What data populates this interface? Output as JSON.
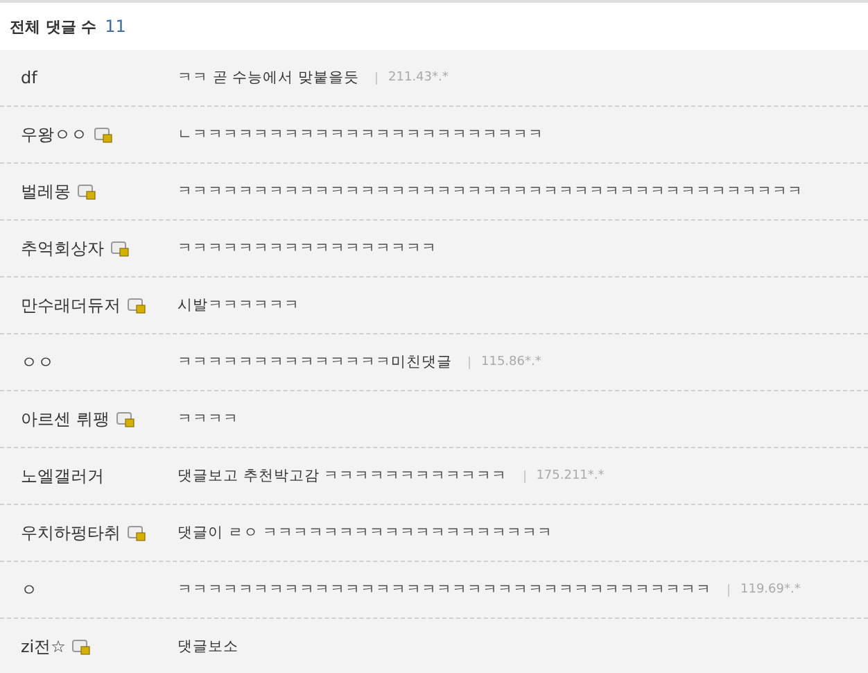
{
  "header": {
    "label": "전체 댓글 수",
    "count": "11"
  },
  "comments": [
    {
      "name": "df",
      "member_icon": false,
      "text": "ㅋㅋ 곧 수능에서 맞붙을듯",
      "ip": "211.43*.*"
    },
    {
      "name": "우왕ㅇㅇ",
      "member_icon": true,
      "text": "ㄴㅋㅋㅋㅋㅋㅋㅋㅋㅋㅋㅋㅋㅋㅋㅋㅋㅋㅋㅋㅋㅋㅋㅋ"
    },
    {
      "name": "벌레몽",
      "member_icon": true,
      "text": "ㅋㅋㅋㅋㅋㅋㅋㅋㅋㅋㅋㅋㅋㅋㅋㅋㅋㅋㅋㅋㅋㅋㅋㅋㅋㅋㅋㅋㅋㅋㅋㅋㅋㅋㅋㅋㅋㅋㅋㅋㅋ"
    },
    {
      "name": "추억회상자",
      "member_icon": true,
      "text": "ㅋㅋㅋㅋㅋㅋㅋㅋㅋㅋㅋㅋㅋㅋㅋㅋㅋ"
    },
    {
      "name": "만수래더듀저",
      "member_icon": true,
      "text": "시발ㅋㅋㅋㅋㅋㅋ"
    },
    {
      "name": "ㅇㅇ",
      "member_icon": false,
      "text": "ㅋㅋㅋㅋㅋㅋㅋㅋㅋㅋㅋㅋㅋㅋ미친댓글",
      "ip": "115.86*.*"
    },
    {
      "name": "아르센 뤼팽",
      "member_icon": true,
      "text": "ㅋㅋㅋㅋ"
    },
    {
      "name": "노엘갤러거",
      "member_icon": false,
      "text": "댓글보고 추천박고감 ㅋㅋㅋㅋㅋㅋㅋㅋㅋㅋㅋㅋ",
      "ip": "175.211*.*"
    },
    {
      "name": "우치하펑타취",
      "member_icon": true,
      "text": "댓글이 ㄹㅇ ㅋㅋㅋㅋㅋㅋㅋㅋㅋㅋㅋㅋㅋㅋㅋㅋㅋㅋㅋ"
    },
    {
      "name": "ㅇ",
      "member_icon": false,
      "text": "ㅋㅋㅋㅋㅋㅋㅋㅋㅋㅋㅋㅋㅋㅋㅋㅋㅋㅋㅋㅋㅋㅋㅋㅋㅋㅋㅋㅋㅋㅋㅋㅋㅋㅋㅋ",
      "ip": "119.69*.*"
    },
    {
      "name": "zi전☆",
      "member_icon": true,
      "text": "댓글보소"
    }
  ]
}
